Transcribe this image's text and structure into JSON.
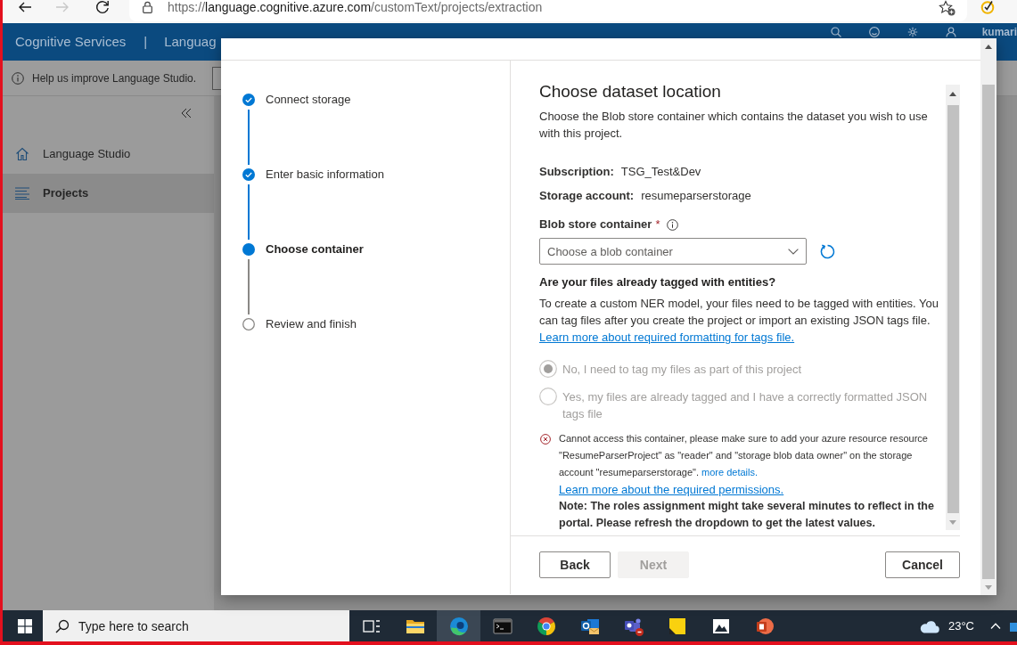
{
  "browser": {
    "address": {
      "scheme": "https://",
      "host": "language.cognitive.azure.com",
      "path": "/customText/projects/extraction"
    },
    "forward_disabled": true
  },
  "header": {
    "brand": "Cognitive Services",
    "separator": "|",
    "section": "Languag",
    "user": "kumari"
  },
  "info_bar": {
    "message": "Help us improve Language Studio."
  },
  "sidebar": {
    "items": [
      {
        "label": "Language Studio",
        "kind": "home",
        "selected": false
      },
      {
        "label": "Projects",
        "kind": "list",
        "selected": true
      }
    ]
  },
  "dialog": {
    "steps": [
      {
        "label": "Connect storage",
        "completed": true,
        "selected": false
      },
      {
        "label": "Enter basic information",
        "completed": true,
        "selected": false
      },
      {
        "label": "Choose container",
        "completed": false,
        "selected": true
      },
      {
        "label": "Review and finish",
        "completed": false,
        "selected": false
      }
    ],
    "title": "Choose dataset location",
    "description": "Choose the Blob store container which contains the dataset you wish to use with this project.",
    "details": [
      {
        "label": "Subscription:",
        "value": "TSG_Test&Dev"
      },
      {
        "label": "Storage account:",
        "value": "resumeparserstorage"
      }
    ],
    "container_field": {
      "label": "Blob store container",
      "required_mark": "*",
      "placeholder": "Choose a blob container"
    },
    "tagging": {
      "question": "Are your files already tagged with entities?",
      "text": "To create a custom NER model, your files need to be tagged with entities. You can tag files after you create the project or import an existing JSON tags file.",
      "link": "Learn more about required formatting for tags file.",
      "options": [
        {
          "label": "No, I need to tag my files as part of this project",
          "selected": true,
          "disabled": true
        },
        {
          "label": "Yes, my files are already tagged and I have a correctly formatted JSON tags file",
          "selected": false,
          "disabled": true
        }
      ]
    },
    "error": {
      "message": "Cannot access this container, please make sure to add your azure resource resource \"ResumeParserProject\" as \"reader\" and \"storage blob data owner\" on the storage account \"resumeparserstorage\".",
      "details_link": "more details.",
      "permissions_link": "Learn more about the required permissions.",
      "note": "Note: The roles assignment might take several minutes to reflect in the portal. Please refresh the dropdown to get the latest values."
    },
    "footer": {
      "left_buttons": [
        {
          "label": "Back",
          "disabled": false
        },
        {
          "label": "Next",
          "disabled": true
        }
      ],
      "right_buttons": [
        {
          "label": "Cancel",
          "disabled": false
        }
      ]
    }
  },
  "taskbar": {
    "search": {
      "placeholder": "Type here to search"
    },
    "apps": [
      {
        "kind": "task_view",
        "selected": false
      },
      {
        "kind": "files",
        "selected": false
      },
      {
        "kind": "browser",
        "selected": true
      },
      {
        "kind": "terminal",
        "selected": false
      },
      {
        "kind": "web",
        "selected": false
      },
      {
        "kind": "mail",
        "selected": false
      },
      {
        "kind": "chat",
        "selected": false
      },
      {
        "kind": "notes",
        "selected": false
      },
      {
        "kind": "photos",
        "selected": false
      },
      {
        "kind": "slides",
        "selected": false
      }
    ],
    "temperature": "23°C"
  }
}
